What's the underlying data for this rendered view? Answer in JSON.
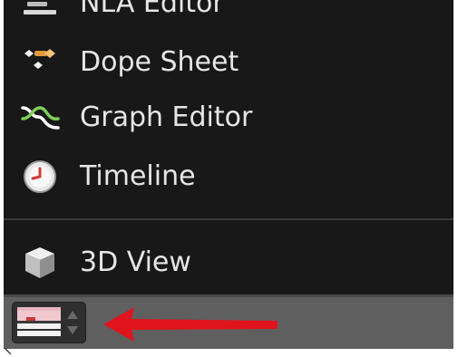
{
  "editor_type_menu": {
    "items": [
      {
        "label": "NLA Editor",
        "icon": "nla-editor-icon"
      },
      {
        "label": "Dope Sheet",
        "icon": "dope-sheet-icon"
      },
      {
        "label": "Graph Editor",
        "icon": "graph-editor-icon"
      },
      {
        "label": "Timeline",
        "icon": "timeline-icon"
      },
      {
        "label": "3D View",
        "icon": "3d-view-icon"
      }
    ]
  },
  "header_bar": {
    "editor_type_button": {
      "icon": "timeline-editor-icon",
      "dropdown_icon": "up-down-arrows-icon"
    },
    "annotation_arrow": {
      "icon": "red-arrow-icon",
      "color": "#e0141c"
    }
  },
  "colors": {
    "menu_background": "#181818",
    "menu_text": "#e6e6e6",
    "bar_background": "#5f5f5f",
    "annotation": "#e0141c"
  }
}
